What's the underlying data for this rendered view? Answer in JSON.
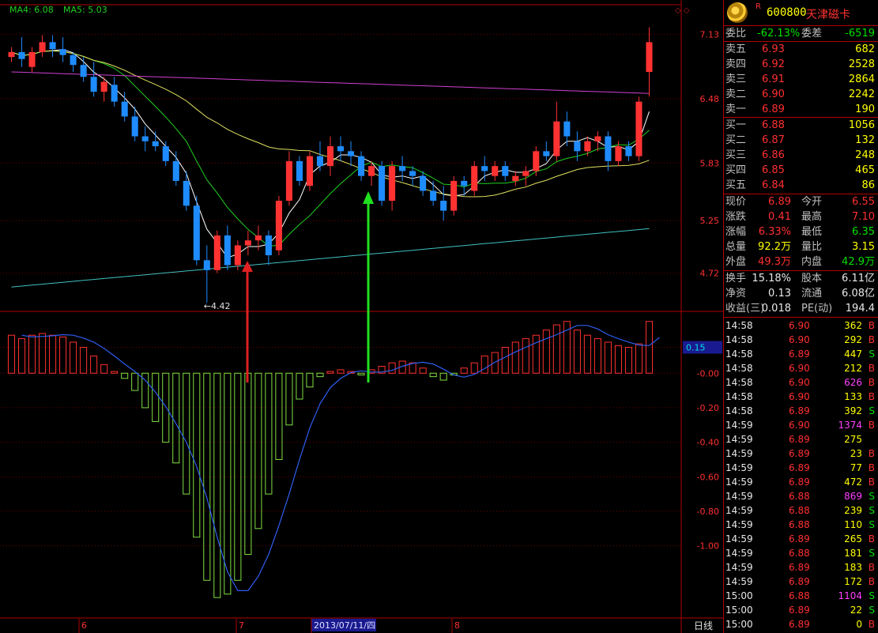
{
  "indicators": {
    "ma4_label": "MA4: 6.08",
    "ma5_label": "MA5: 5.03",
    "price_ticks": [
      "7.13",
      "6.48",
      "5.83",
      "5.25",
      "4.72"
    ],
    "osc_ticks": [
      "0.15",
      "-0.00",
      "-0.20",
      "-0.40",
      "-0.60",
      "-0.80",
      "-1.00"
    ],
    "low_label": "4.42",
    "x_labels": [
      "6",
      "7",
      "2013/07/11/四",
      "8"
    ],
    "period_label": "日线",
    "colors": {
      "up": "#ff3232",
      "down": "#1e8cff",
      "ma_white": "#ffffff",
      "ma_green": "#20d020",
      "ma_yellow": "#e0e060",
      "ma_magenta": "#d040d0",
      "ma_cyan": "#40c0c0",
      "osc_pos": "#ff3030",
      "osc_neg": "#80e040",
      "osc_line": "#2e5ef0"
    }
  },
  "chart_data": {
    "type": "candlestick",
    "ohlc": [
      [
        6.9,
        7.0,
        6.85,
        6.95
      ],
      [
        6.95,
        7.1,
        6.8,
        6.88
      ],
      [
        6.8,
        7.0,
        6.75,
        6.95
      ],
      [
        6.95,
        7.12,
        6.9,
        7.05
      ],
      [
        7.05,
        7.12,
        6.9,
        6.98
      ],
      [
        6.98,
        7.1,
        6.85,
        6.92
      ],
      [
        6.92,
        6.95,
        6.75,
        6.82
      ],
      [
        6.82,
        6.9,
        6.65,
        6.7
      ],
      [
        6.7,
        6.85,
        6.5,
        6.55
      ],
      [
        6.55,
        6.7,
        6.45,
        6.65
      ],
      [
        6.62,
        6.7,
        6.4,
        6.45
      ],
      [
        6.45,
        6.55,
        6.25,
        6.3
      ],
      [
        6.3,
        6.4,
        6.05,
        6.1
      ],
      [
        6.1,
        6.2,
        5.95,
        6.05
      ],
      [
        6.05,
        6.15,
        5.95,
        6.0
      ],
      [
        6.0,
        6.05,
        5.8,
        5.85
      ],
      [
        5.85,
        5.95,
        5.6,
        5.65
      ],
      [
        5.65,
        5.75,
        5.35,
        5.4
      ],
      [
        5.4,
        5.5,
        4.8,
        4.85
      ],
      [
        4.85,
        5.0,
        4.42,
        4.75
      ],
      [
        4.75,
        5.15,
        4.72,
        5.1
      ],
      [
        5.1,
        5.2,
        4.75,
        4.8
      ],
      [
        4.8,
        5.05,
        4.75,
        5.0
      ],
      [
        5.0,
        5.15,
        4.9,
        5.05
      ],
      [
        5.05,
        5.2,
        4.95,
        5.1
      ],
      [
        5.1,
        5.15,
        4.8,
        4.9
      ],
      [
        4.95,
        5.5,
        4.9,
        5.45
      ],
      [
        5.45,
        5.95,
        5.4,
        5.85
      ],
      [
        5.85,
        5.9,
        5.6,
        5.65
      ],
      [
        5.6,
        5.95,
        5.55,
        5.9
      ],
      [
        5.9,
        6.05,
        5.75,
        5.8
      ],
      [
        5.8,
        6.1,
        5.7,
        6.0
      ],
      [
        6.0,
        6.1,
        5.85,
        5.95
      ],
      [
        5.95,
        6.05,
        5.8,
        5.9
      ],
      [
        5.9,
        5.95,
        5.65,
        5.7
      ],
      [
        5.7,
        5.85,
        5.6,
        5.8
      ],
      [
        5.8,
        5.85,
        5.4,
        5.45
      ],
      [
        5.45,
        5.85,
        5.35,
        5.8
      ],
      [
        5.8,
        5.9,
        5.65,
        5.75
      ],
      [
        5.75,
        5.8,
        5.6,
        5.7
      ],
      [
        5.7,
        5.75,
        5.5,
        5.55
      ],
      [
        5.55,
        5.65,
        5.4,
        5.45
      ],
      [
        5.45,
        5.6,
        5.25,
        5.35
      ],
      [
        5.35,
        5.7,
        5.3,
        5.65
      ],
      [
        5.65,
        5.7,
        5.5,
        5.6
      ],
      [
        5.55,
        5.85,
        5.5,
        5.8
      ],
      [
        5.8,
        5.9,
        5.65,
        5.75
      ],
      [
        5.7,
        5.85,
        5.65,
        5.8
      ],
      [
        5.8,
        5.85,
        5.65,
        5.7
      ],
      [
        5.65,
        5.75,
        5.6,
        5.7
      ],
      [
        5.7,
        5.8,
        5.6,
        5.75
      ],
      [
        5.75,
        6.0,
        5.7,
        5.95
      ],
      [
        5.95,
        6.05,
        5.85,
        5.9
      ],
      [
        5.9,
        6.45,
        5.85,
        6.25
      ],
      [
        6.25,
        6.35,
        6.0,
        6.1
      ],
      [
        6.05,
        6.15,
        5.85,
        5.95
      ],
      [
        5.95,
        6.1,
        5.9,
        6.05
      ],
      [
        6.05,
        6.15,
        5.95,
        6.1
      ],
      [
        6.1,
        6.15,
        5.75,
        5.85
      ],
      [
        5.85,
        6.05,
        5.8,
        6.0
      ],
      [
        6.0,
        6.05,
        5.85,
        5.9
      ],
      [
        5.9,
        6.5,
        5.85,
        6.45
      ],
      [
        6.75,
        7.2,
        6.5,
        7.05
      ]
    ],
    "oscillator": [
      0.22,
      0.2,
      0.22,
      0.23,
      0.22,
      0.21,
      0.18,
      0.15,
      0.1,
      0.05,
      0.01,
      -0.03,
      -0.1,
      -0.2,
      -0.28,
      -0.4,
      -0.52,
      -0.7,
      -0.95,
      -1.2,
      -1.3,
      -1.28,
      -1.2,
      -1.05,
      -0.9,
      -0.7,
      -0.5,
      -0.3,
      -0.15,
      -0.08,
      -0.02,
      0.01,
      0.02,
      0.01,
      -0.01,
      0.02,
      0.04,
      0.06,
      0.07,
      0.06,
      0.03,
      -0.02,
      -0.04,
      -0.01,
      0.03,
      0.06,
      0.1,
      0.12,
      0.15,
      0.18,
      0.2,
      0.22,
      0.25,
      0.28,
      0.3,
      0.25,
      0.22,
      0.2,
      0.18,
      0.16,
      0.15,
      0.17,
      0.3
    ],
    "price_axis": {
      "min": 4.35,
      "max": 7.3
    },
    "osc_axis": {
      "min": -1.4,
      "max": 0.34
    }
  },
  "quote_panel": {
    "code": "600800",
    "name": "天津磁卡",
    "flag": "R",
    "wb": {
      "label": "委比",
      "value": "-62.13%",
      "label2": "委差",
      "value2": "-6519"
    },
    "asks": [
      {
        "label": "卖五",
        "price": "6.93",
        "vol": "682"
      },
      {
        "label": "卖四",
        "price": "6.92",
        "vol": "2528"
      },
      {
        "label": "卖三",
        "price": "6.91",
        "vol": "2864"
      },
      {
        "label": "卖二",
        "price": "6.90",
        "vol": "2242"
      },
      {
        "label": "卖一",
        "price": "6.89",
        "vol": "190"
      }
    ],
    "bids": [
      {
        "label": "买一",
        "price": "6.88",
        "vol": "1056"
      },
      {
        "label": "买二",
        "price": "6.87",
        "vol": "132"
      },
      {
        "label": "买三",
        "price": "6.86",
        "vol": "248"
      },
      {
        "label": "买四",
        "price": "6.85",
        "vol": "465"
      },
      {
        "label": "买五",
        "price": "6.84",
        "vol": "86"
      }
    ],
    "stats": [
      {
        "l1": "现价",
        "v1": "6.89",
        "c1": "red",
        "l2": "今开",
        "v2": "6.55",
        "c2": "red"
      },
      {
        "l1": "涨跌",
        "v1": "0.41",
        "c1": "red",
        "l2": "最高",
        "v2": "7.10",
        "c2": "red"
      },
      {
        "l1": "涨幅",
        "v1": "6.33%",
        "c1": "red",
        "l2": "最低",
        "v2": "6.35",
        "c2": "green"
      },
      {
        "l1": "总量",
        "v1": "92.2万",
        "c1": "yel",
        "l2": "量比",
        "v2": "3.15",
        "c2": "yel"
      },
      {
        "l1": "外盘",
        "v1": "49.3万",
        "c1": "red",
        "l2": "内盘",
        "v2": "42.9万",
        "c2": "green"
      }
    ],
    "fund": [
      {
        "l1": "换手",
        "v1": "15.18%",
        "l2": "股本",
        "v2": "6.11亿"
      },
      {
        "l1": "净资",
        "v1": "0.13",
        "l2": "流通",
        "v2": "6.08亿"
      },
      {
        "l1": "收益(三)",
        "v1": "0.018",
        "l2": "PE(动)",
        "v2": "194.4"
      }
    ],
    "ticks": [
      {
        "t": "14:58",
        "p": "6.90",
        "v": "362",
        "bs": "B",
        "vc": "yel"
      },
      {
        "t": "14:58",
        "p": "6.90",
        "v": "292",
        "bs": "B",
        "vc": "yel"
      },
      {
        "t": "14:58",
        "p": "6.89",
        "v": "447",
        "bs": "S",
        "vc": "yel"
      },
      {
        "t": "14:58",
        "p": "6.90",
        "v": "212",
        "bs": "B",
        "vc": "yel"
      },
      {
        "t": "14:58",
        "p": "6.90",
        "v": "626",
        "bs": "B",
        "vc": "mag"
      },
      {
        "t": "14:58",
        "p": "6.90",
        "v": "133",
        "bs": "B",
        "vc": "yel"
      },
      {
        "t": "14:58",
        "p": "6.89",
        "v": "392",
        "bs": "S",
        "vc": "yel"
      },
      {
        "t": "14:59",
        "p": "6.90",
        "v": "1374",
        "bs": "B",
        "vc": "mag"
      },
      {
        "t": "14:59",
        "p": "6.89",
        "v": "275",
        "bs": "",
        "vc": "yel"
      },
      {
        "t": "14:59",
        "p": "6.89",
        "v": "23",
        "bs": "B",
        "vc": "yel"
      },
      {
        "t": "14:59",
        "p": "6.89",
        "v": "77",
        "bs": "B",
        "vc": "yel"
      },
      {
        "t": "14:59",
        "p": "6.89",
        "v": "472",
        "bs": "B",
        "vc": "yel"
      },
      {
        "t": "14:59",
        "p": "6.88",
        "v": "869",
        "bs": "S",
        "vc": "mag"
      },
      {
        "t": "14:59",
        "p": "6.88",
        "v": "239",
        "bs": "S",
        "vc": "yel"
      },
      {
        "t": "14:59",
        "p": "6.88",
        "v": "110",
        "bs": "S",
        "vc": "yel"
      },
      {
        "t": "14:59",
        "p": "6.89",
        "v": "265",
        "bs": "B",
        "vc": "yel"
      },
      {
        "t": "14:59",
        "p": "6.88",
        "v": "181",
        "bs": "S",
        "vc": "yel"
      },
      {
        "t": "14:59",
        "p": "6.89",
        "v": "183",
        "bs": "B",
        "vc": "yel"
      },
      {
        "t": "14:59",
        "p": "6.89",
        "v": "172",
        "bs": "B",
        "vc": "yel"
      },
      {
        "t": "15:00",
        "p": "6.88",
        "v": "1104",
        "bs": "S",
        "vc": "mag"
      },
      {
        "t": "15:00",
        "p": "6.89",
        "v": "22",
        "bs": "S",
        "vc": "yel"
      },
      {
        "t": "15:00",
        "p": "6.89",
        "v": "0",
        "bs": "B",
        "vc": "yel"
      }
    ]
  }
}
